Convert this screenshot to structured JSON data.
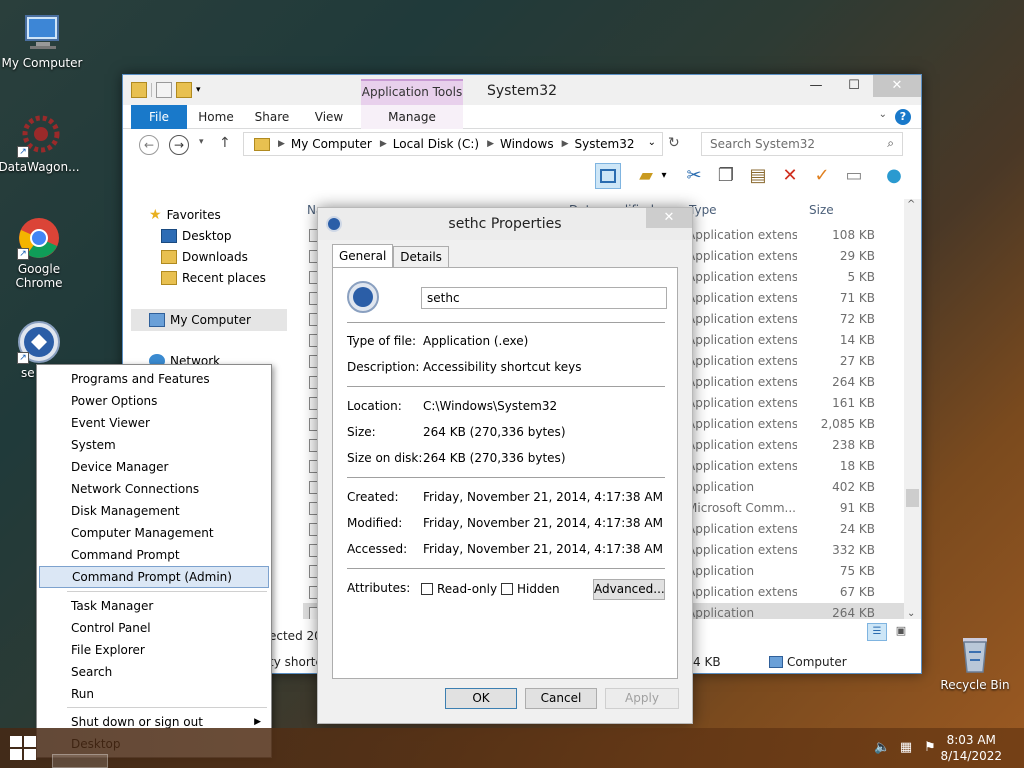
{
  "desktop": {
    "icons": [
      {
        "label": "My Computer"
      },
      {
        "label": "DataWagon..."
      },
      {
        "label": "Google Chrome"
      },
      {
        "label": "se"
      },
      {
        "label": "Recycle Bin"
      }
    ]
  },
  "explorer": {
    "title": "System32",
    "context_tab": "Application Tools",
    "tabs": [
      "File",
      "Home",
      "Share",
      "View",
      "Manage"
    ],
    "address": [
      "My Computer",
      "Local Disk (C:)",
      "Windows",
      "System32"
    ],
    "search_placeholder": "Search System32",
    "nav": {
      "favorites": "Favorites",
      "desktop": "Desktop",
      "downloads": "Downloads",
      "recent": "Recent places",
      "my_computer": "My Computer",
      "network": "Network"
    },
    "columns": {
      "name": "Name",
      "date": "Date modified",
      "type": "Type",
      "size": "Size"
    },
    "rows": [
      {
        "type": "Application extens...",
        "size": "108 KB"
      },
      {
        "type": "Application extens...",
        "size": "29 KB"
      },
      {
        "type": "Application extens...",
        "size": "5 KB"
      },
      {
        "type": "Application extens...",
        "size": "71 KB"
      },
      {
        "type": "Application extens...",
        "size": "72 KB"
      },
      {
        "type": "Application extens...",
        "size": "14 KB"
      },
      {
        "type": "Application extens...",
        "size": "27 KB"
      },
      {
        "type": "Application extens...",
        "size": "264 KB"
      },
      {
        "type": "Application extens...",
        "size": "161 KB"
      },
      {
        "type": "Application extens...",
        "size": "2,085 KB"
      },
      {
        "type": "Application extens...",
        "size": "238 KB"
      },
      {
        "type": "Application extens...",
        "size": "18 KB"
      },
      {
        "type": "Application",
        "size": "402 KB"
      },
      {
        "type": "Microsoft Comm...",
        "size": "91 KB"
      },
      {
        "type": "Application extens...",
        "size": "24 KB"
      },
      {
        "type": "Application extens...",
        "size": "332 KB"
      },
      {
        "type": "Application",
        "size": "75 KB"
      },
      {
        "type": "Application extens...",
        "size": "67 KB"
      },
      {
        "type": "Application",
        "size": "264 KB"
      }
    ],
    "status": {
      "selected": "ected 20",
      "details": "ty shortc",
      "size": "4 KB",
      "location": "Computer"
    }
  },
  "dialog": {
    "title": "sethc Properties",
    "tabs": [
      "General",
      "Details"
    ],
    "name": "sethc",
    "type_label": "Type of file:",
    "type_value": "Application (.exe)",
    "desc_label": "Description:",
    "desc_value": "Accessibility shortcut keys",
    "loc_label": "Location:",
    "loc_value": "C:\\Windows\\System32",
    "size_label": "Size:",
    "size_value": "264 KB (270,336 bytes)",
    "disk_label": "Size on disk:",
    "disk_value": "264 KB (270,336 bytes)",
    "created_label": "Created:",
    "created_value": "Friday, November 21, 2014, 4:17:38 AM",
    "modified_label": "Modified:",
    "modified_value": "Friday, November 21, 2014, 4:17:38 AM",
    "accessed_label": "Accessed:",
    "accessed_value": "Friday, November 21, 2014, 4:17:38 AM",
    "attr_label": "Attributes:",
    "readonly": "Read-only",
    "hidden": "Hidden",
    "advanced": "Advanced...",
    "ok": "OK",
    "cancel": "Cancel",
    "apply": "Apply"
  },
  "winx_menu": {
    "group1": [
      "Programs and Features",
      "Power Options",
      "Event Viewer",
      "System",
      "Device Manager",
      "Network Connections",
      "Disk Management",
      "Computer Management",
      "Command Prompt",
      "Command Prompt (Admin)"
    ],
    "group2": [
      "Task Manager",
      "Control Panel",
      "File Explorer",
      "Search",
      "Run"
    ],
    "group3": [
      "Shut down or sign out",
      "Desktop"
    ]
  },
  "taskbar": {
    "time": "8:03 AM",
    "date": "8/14/2022"
  }
}
